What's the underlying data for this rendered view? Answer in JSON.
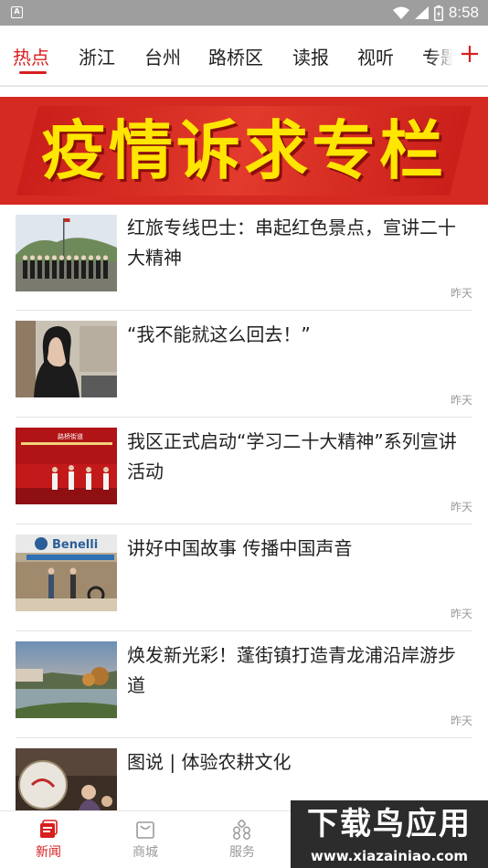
{
  "status_bar": {
    "app_icon_glyph": "A",
    "clock": "8:58"
  },
  "tabs": [
    {
      "label": "热点",
      "active": true
    },
    {
      "label": "浙江",
      "active": false
    },
    {
      "label": "台州",
      "active": false
    },
    {
      "label": "路桥区",
      "active": false
    },
    {
      "label": "读报",
      "active": false
    },
    {
      "label": "视听",
      "active": false
    },
    {
      "label": "专题",
      "active": false
    }
  ],
  "add_tab_icon": "plus-icon",
  "banner": {
    "title": "疫情诉求专栏"
  },
  "news": [
    {
      "title": "红旅专线巴士：串起红色景点，宣讲二十大精神",
      "time": "昨天"
    },
    {
      "title": "“我不能就这么回去！”",
      "time": "昨天"
    },
    {
      "title": "我区正式启动“学习二十大精神”系列宣讲活动",
      "time": "昨天"
    },
    {
      "title": "讲好中国故事 传播中国声音",
      "time": "昨天"
    },
    {
      "title": "焕发新光彩！蓬街镇打造青龙浦沿岸游步道",
      "time": "昨天"
    },
    {
      "title": "图说 | 体验农耕文化",
      "time": ""
    }
  ],
  "photo_lettering": {
    "item4_sign": "Benelli",
    "item3_banner": "路桥街道"
  },
  "bottom_nav": [
    {
      "label": "新闻",
      "icon": "news-icon",
      "active": true
    },
    {
      "label": "商城",
      "icon": "shopping-bag-icon",
      "active": false
    },
    {
      "label": "服务",
      "icon": "grid-services-icon",
      "active": false
    }
  ],
  "watermark": {
    "title": "下载鸟应用",
    "url": "www.xiazainiao.com"
  },
  "colors": {
    "accent": "#d81e1e",
    "status_bar": "#9e9e9e",
    "banner_red": "#d52a22",
    "banner_text": "#ffe600",
    "muted_text": "#9a9a9a"
  }
}
